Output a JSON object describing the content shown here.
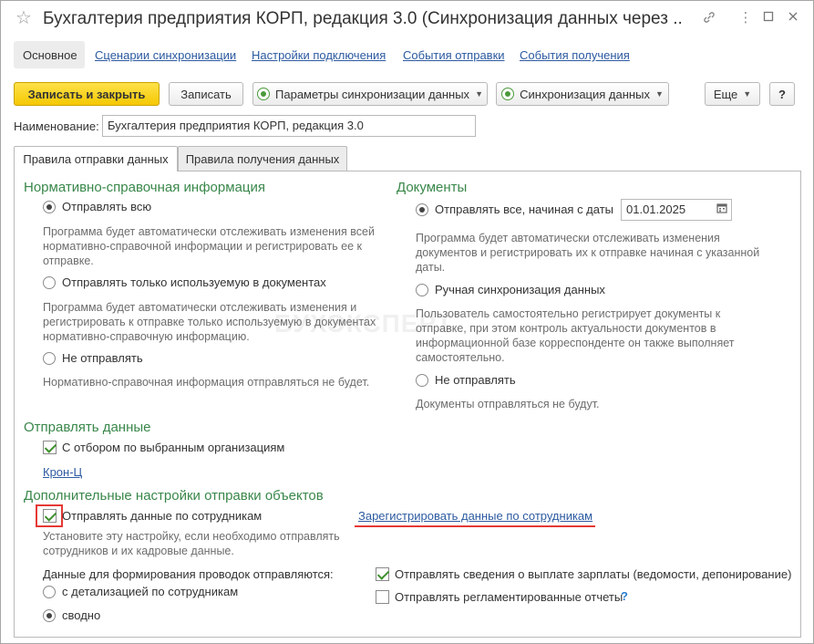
{
  "window": {
    "title": "Бухгалтерия предприятия КОРП, редакция 3.0 (Синхронизация данных через ...",
    "icons": [
      "star-icon",
      "link-icon",
      "more-icon",
      "maximize-icon",
      "close-icon"
    ]
  },
  "nav": {
    "items": [
      "Основное",
      "Сценарии синхронизации",
      "Настройки подключения",
      "События отправки",
      "События получения"
    ]
  },
  "toolbar": {
    "save_close": "Записать и закрыть",
    "save": "Записать",
    "sync_params": "Параметры синхронизации данных",
    "sync": "Синхронизация данных",
    "more": "Еще",
    "help": "?"
  },
  "name": {
    "label": "Наименование:",
    "value": "Бухгалтерия предприятия КОРП, редакция 3.0"
  },
  "tabs": [
    "Правила отправки данных",
    "Правила получения данных"
  ],
  "nsi": {
    "header": "Нормативно-справочная информация",
    "opt_all": "Отправлять всю",
    "desc_all": "Программа будет автоматически отслеживать изменения всей нормативно-справочной информации и регистрировать ее к отправке.",
    "opt_used": "Отправлять только используемую в документах",
    "desc_used": "Программа будет автоматически отслеживать изменения и регистрировать к отправке только используемую в документах нормативно-справочную информацию.",
    "opt_none": "Не отправлять",
    "desc_none": "Нормативно-справочная информация отправляться не будет."
  },
  "docs": {
    "header": "Документы",
    "opt_from": "Отправлять все, начиная с даты",
    "date": "01.01.2025",
    "desc_from": "Программа будет автоматически отслеживать изменения документов и регистрировать их к отправке начиная с указанной даты.",
    "opt_manual": "Ручная синхронизация данных",
    "desc_manual": "Пользователь самостоятельно регистрирует документы к отправке, при этом контроль актуальности документов в информационной базе корреспонденте он также выполняет самостоятельно.",
    "opt_none": "Не отправлять",
    "desc_none": "Документы отправляться не будут."
  },
  "send": {
    "header": "Отправлять данные",
    "filter": "С отбором по выбранным организациям",
    "org_link": "Крон-Ц"
  },
  "extra": {
    "header": "Дополнительные настройки отправки объектов",
    "employees": "Отправлять данные по сотрудникам",
    "register_link": "Зарегистрировать данные по сотрудникам",
    "employees_desc": "Установите эту настройку, если необходимо отправлять сотрудников и их кадровые данные.",
    "postings_label": "Данные для формирования проводок отправляются:",
    "detailed": "с детализацией по сотрудникам",
    "summary": "сводно",
    "salary": "Отправлять сведения о выплате зарплаты (ведомости, депонирование)",
    "reports": "Отправлять регламентированные отчеты",
    "reports_help": "?"
  },
  "watermark": "БУХЭКСПЕРТ"
}
